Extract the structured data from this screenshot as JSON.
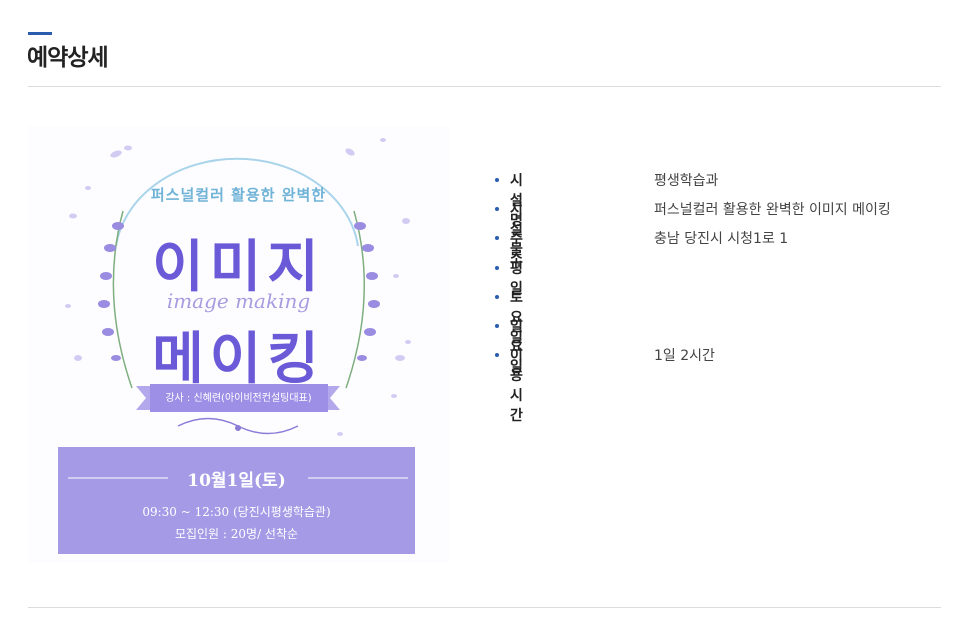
{
  "page": {
    "title": "예약상세"
  },
  "poster": {
    "arc_text": "퍼스널컬러 활용한 완벽한",
    "main_line1": "이미지",
    "subtitle_en": "image making",
    "main_line2": "메이킹",
    "instructor": "강사 : 신혜련(아이비전컨설팅대표)",
    "date": "10월1일(토)",
    "time": "09:30 ~ 12:30  (당진시평생학습관)",
    "recruit": "모집인원    :    20명/ 선착순",
    "colors": {
      "accent": "#6a5ad8",
      "panel": "#a49ae6",
      "arc": "#6fb3d6"
    }
  },
  "details": {
    "rows": [
      {
        "label": "시설명",
        "value": "평생학습과"
      },
      {
        "label": "시설물",
        "value": "퍼스널컬러 활용한 완벽한 이미지 메이킹"
      },
      {
        "label": "주소",
        "value": "충남 당진시 시청1로 1"
      },
      {
        "label": "평일",
        "value": ""
      },
      {
        "label": "토요일",
        "value": ""
      },
      {
        "label": "일요일",
        "value": ""
      },
      {
        "label": "이용시간",
        "value": "1일 2시간"
      }
    ]
  },
  "colors": {
    "title_accent": "#2a5db0",
    "divider": "#dcdcdc"
  }
}
